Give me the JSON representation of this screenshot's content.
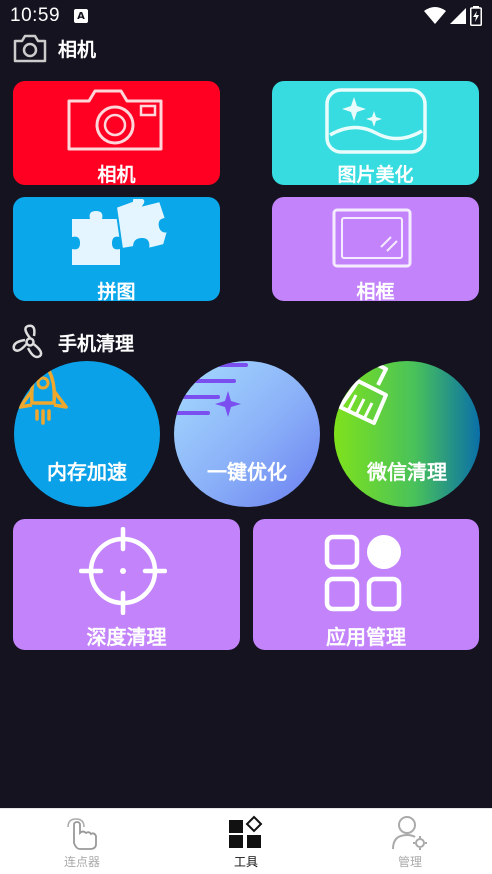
{
  "status_bar": {
    "time": "10:59",
    "notification_icon": "a-badge-icon",
    "right_icons": [
      "wifi-icon",
      "signal-icon",
      "battery-charging-icon"
    ]
  },
  "camera_section": {
    "title": "相机",
    "icon": "camera-outline-icon",
    "tiles": [
      {
        "label": "相机",
        "color": "#ff0022",
        "icon": "camera-icon"
      },
      {
        "label": "图片美化",
        "color": "#36dcdf",
        "icon": "landscape-sparkle-icon"
      },
      {
        "label": "拼图",
        "color": "#0aa7ea",
        "icon": "puzzle-icon"
      },
      {
        "label": "相框",
        "color": "#c384fb",
        "icon": "frame-icon"
      }
    ]
  },
  "cleaner_section": {
    "title": "手机清理",
    "icon": "fan-icon",
    "circles": [
      {
        "label": "内存加速",
        "color": "#0aa1e8",
        "icon": "rocket-icon"
      },
      {
        "label": "一键优化",
        "color_start": "#9fd8fd",
        "color_end": "#6a7ef0",
        "icon": "list-sparkle-icon"
      },
      {
        "label": "微信清理",
        "color_start": "#7fe21c",
        "color_end": "#0a6fa8",
        "icon": "broom-icon"
      }
    ],
    "tiles": [
      {
        "label": "深度清理",
        "color": "#c384fb",
        "icon": "crosshair-icon"
      },
      {
        "label": "应用管理",
        "color": "#c384fb",
        "icon": "apps-grid-icon"
      }
    ]
  },
  "bottom_nav": {
    "items": [
      {
        "label": "连点器",
        "icon": "tap-hand-icon",
        "active": false
      },
      {
        "label": "工具",
        "icon": "tools-grid-icon",
        "active": true
      },
      {
        "label": "管理",
        "icon": "user-gear-icon",
        "active": false
      }
    ]
  }
}
